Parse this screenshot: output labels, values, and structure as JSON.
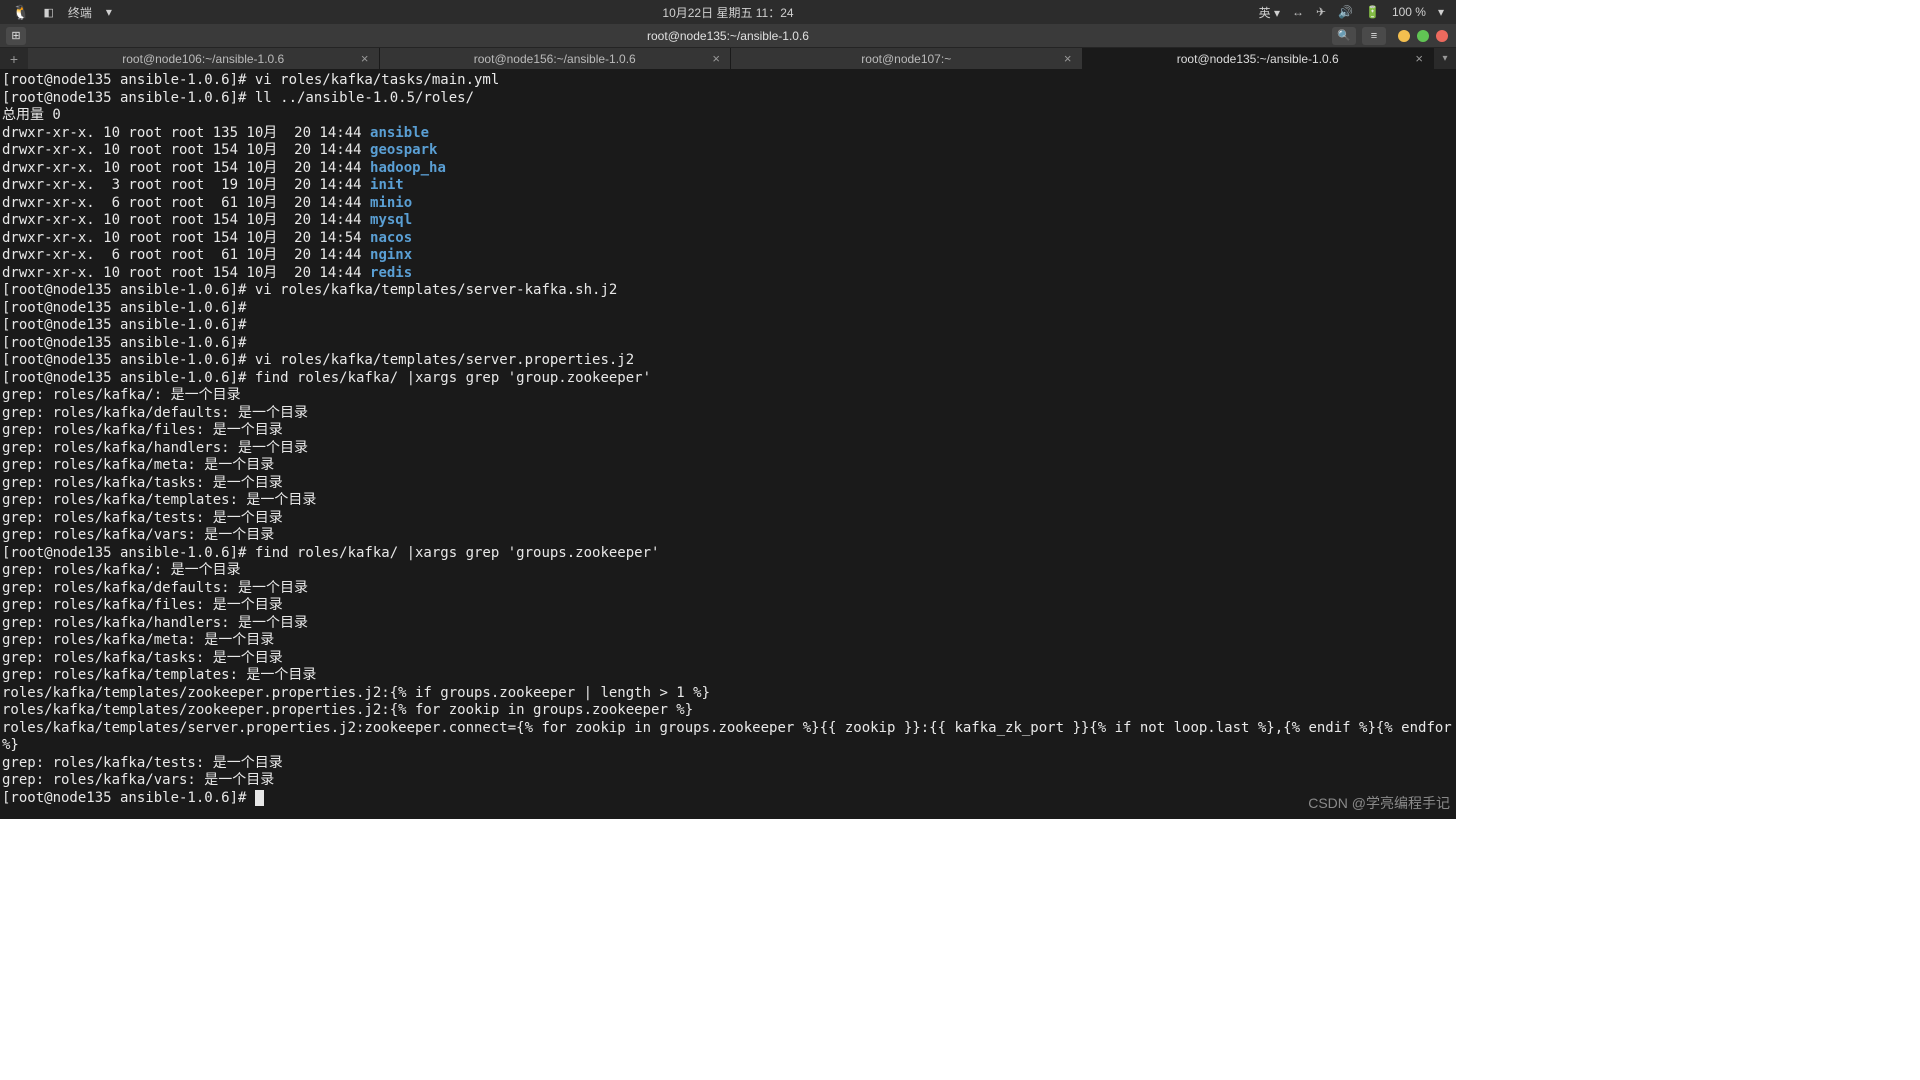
{
  "menubar": {
    "app": "终端",
    "clock": "10月22日 星期五  11：24",
    "lang": "英",
    "battery": "100 %"
  },
  "titlebar": {
    "title": "root@node135:~/ansible-1.0.6"
  },
  "tabs": [
    {
      "label": "root@node106:~/ansible-1.0.6",
      "active": false
    },
    {
      "label": "root@node156:~/ansible-1.0.6",
      "active": false
    },
    {
      "label": "root@node107:~",
      "active": false
    },
    {
      "label": "root@node135:~/ansible-1.0.6",
      "active": true
    }
  ],
  "prompt": "[root@node135 ansible-1.0.6]#",
  "terminal": {
    "lines": [
      {
        "t": "prompt_cmd",
        "cmd": " vi roles/kafka/tasks/main.yml"
      },
      {
        "t": "prompt_cmd",
        "cmd": " ll ../ansible-1.0.5/roles/"
      },
      {
        "t": "plain",
        "text": "总用量 0"
      },
      {
        "t": "ls",
        "perm": "drwxr-xr-x. 10 root root 135 10月  20 14:44 ",
        "name": "ansible"
      },
      {
        "t": "ls",
        "perm": "drwxr-xr-x. 10 root root 154 10月  20 14:44 ",
        "name": "geospark"
      },
      {
        "t": "ls",
        "perm": "drwxr-xr-x. 10 root root 154 10月  20 14:44 ",
        "name": "hadoop_ha"
      },
      {
        "t": "ls",
        "perm": "drwxr-xr-x.  3 root root  19 10月  20 14:44 ",
        "name": "init"
      },
      {
        "t": "ls",
        "perm": "drwxr-xr-x.  6 root root  61 10月  20 14:44 ",
        "name": "minio"
      },
      {
        "t": "ls",
        "perm": "drwxr-xr-x. 10 root root 154 10月  20 14:44 ",
        "name": "mysql"
      },
      {
        "t": "ls",
        "perm": "drwxr-xr-x. 10 root root 154 10月  20 14:54 ",
        "name": "nacos"
      },
      {
        "t": "ls",
        "perm": "drwxr-xr-x.  6 root root  61 10月  20 14:44 ",
        "name": "nginx"
      },
      {
        "t": "ls",
        "perm": "drwxr-xr-x. 10 root root 154 10月  20 14:44 ",
        "name": "redis"
      },
      {
        "t": "prompt_cmd",
        "cmd": " vi roles/kafka/templates/server-kafka.sh.j2"
      },
      {
        "t": "prompt_cmd",
        "cmd": " "
      },
      {
        "t": "prompt_cmd",
        "cmd": " "
      },
      {
        "t": "prompt_cmd",
        "cmd": " "
      },
      {
        "t": "prompt_cmd",
        "cmd": " vi roles/kafka/templates/server.properties.j2"
      },
      {
        "t": "prompt_cmd",
        "cmd": " find roles/kafka/ |xargs grep 'group.zookeeper'"
      },
      {
        "t": "plain",
        "text": "grep: roles/kafka/: 是一个目录"
      },
      {
        "t": "plain",
        "text": "grep: roles/kafka/defaults: 是一个目录"
      },
      {
        "t": "plain",
        "text": "grep: roles/kafka/files: 是一个目录"
      },
      {
        "t": "plain",
        "text": "grep: roles/kafka/handlers: 是一个目录"
      },
      {
        "t": "plain",
        "text": "grep: roles/kafka/meta: 是一个目录"
      },
      {
        "t": "plain",
        "text": "grep: roles/kafka/tasks: 是一个目录"
      },
      {
        "t": "plain",
        "text": "grep: roles/kafka/templates: 是一个目录"
      },
      {
        "t": "plain",
        "text": "grep: roles/kafka/tests: 是一个目录"
      },
      {
        "t": "plain",
        "text": "grep: roles/kafka/vars: 是一个目录"
      },
      {
        "t": "prompt_cmd",
        "cmd": " find roles/kafka/ |xargs grep 'groups.zookeeper'"
      },
      {
        "t": "plain",
        "text": "grep: roles/kafka/: 是一个目录"
      },
      {
        "t": "plain",
        "text": "grep: roles/kafka/defaults: 是一个目录"
      },
      {
        "t": "plain",
        "text": "grep: roles/kafka/files: 是一个目录"
      },
      {
        "t": "plain",
        "text": "grep: roles/kafka/handlers: 是一个目录"
      },
      {
        "t": "plain",
        "text": "grep: roles/kafka/meta: 是一个目录"
      },
      {
        "t": "plain",
        "text": "grep: roles/kafka/tasks: 是一个目录"
      },
      {
        "t": "plain",
        "text": "grep: roles/kafka/templates: 是一个目录"
      },
      {
        "t": "plain",
        "text": "roles/kafka/templates/zookeeper.properties.j2:{% if groups.zookeeper | length > 1 %}"
      },
      {
        "t": "plain",
        "text": "roles/kafka/templates/zookeeper.properties.j2:{% for zookip in groups.zookeeper %}"
      },
      {
        "t": "plain",
        "text": "roles/kafka/templates/server.properties.j2:zookeeper.connect={% for zookip in groups.zookeeper %}{{ zookip }}:{{ kafka_zk_port }}{% if not loop.last %},{% endif %}{% endfor"
      },
      {
        "t": "plain",
        "text": "%}"
      },
      {
        "t": "plain",
        "text": "grep: roles/kafka/tests: 是一个目录"
      },
      {
        "t": "plain",
        "text": "grep: roles/kafka/vars: 是一个目录"
      },
      {
        "t": "prompt_cursor"
      }
    ]
  },
  "watermark": "CSDN @学亮编程手记"
}
